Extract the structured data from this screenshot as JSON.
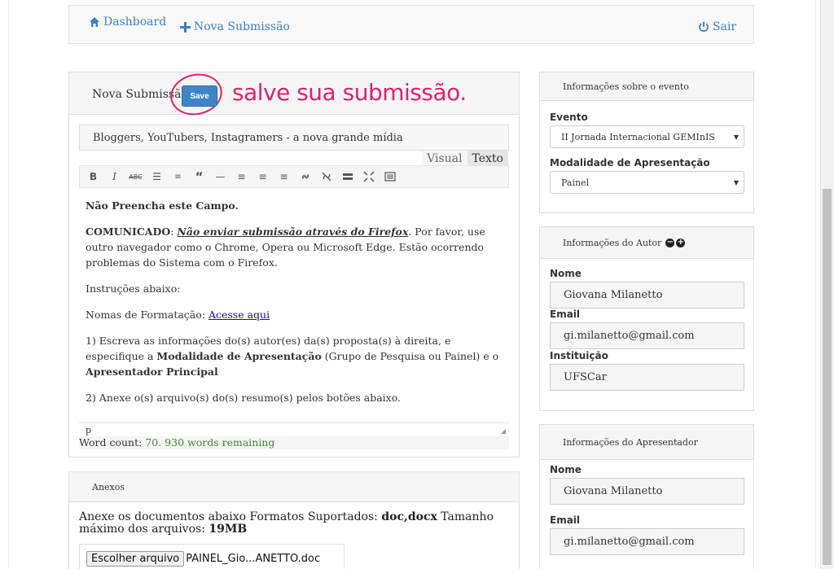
{
  "nav": {
    "dashboard": "Dashboard",
    "new_submission": "Nova Submissão",
    "logout": "Sair"
  },
  "submission": {
    "panel_title": "Nova Submissão",
    "save_label": "Save",
    "annotation": "salve sua submissão.",
    "title_value": "Bloggers, YouTubers, Instagramers - a nova grande mídia",
    "tabs": [
      "Visual",
      "Texto"
    ],
    "toolbar_icons": [
      "bold-icon",
      "italic-icon",
      "strikethrough-icon",
      "bullet-list-icon",
      "numbered-list-icon",
      "blockquote-icon",
      "horizontal-rule-icon",
      "align-left-icon",
      "align-center-icon",
      "align-right-icon",
      "link-icon",
      "unlink-icon",
      "read-more-icon",
      "fullscreen-icon",
      "toolbar-toggle-icon"
    ],
    "body": {
      "p1": "Não Preencha este Campo.",
      "p2_strong": "COMUNICADO",
      "p2_sep": ": ",
      "p2_em": "Não enviar submissão através do Firefox",
      "p2_rest": ". Por favor, use outro navegador como o Chrome, Opera ou Microsoft Edge. Estão ocorrendo problemas do Sistema com o Firefox.",
      "p3": "Instruções abaixo:",
      "p4_text": "Nomas de Formatação: ",
      "p4_link": "Acesse aqui",
      "p5_a": "1) Escreva as informações do(s) autor(es) da(s) proposta(s) à direita, e especifique a ",
      "p5_b": "Modalidade de Apresentação",
      "p5_c": " (Grupo de Pesquisa ou Painel) e o ",
      "p5_d": "Apresentador Principal",
      "p6": "2) Anexe o(s) arquivo(s) do(s) resumo(s) pelos botões abaixo."
    },
    "status_path": "p",
    "word_count_label": "Word count: ",
    "word_count_value": "70. 930 words remaining"
  },
  "anexos": {
    "title": "Anexos",
    "text_a": "Anexe os documentos abaixo Formatos Suportados: ",
    "formats": "doc,docx",
    "text_b": " Tamanho máximo dos arquivos: ",
    "max_size": "19MB",
    "file_button": "Escolher arquivo",
    "file_name": "PAINEL_Gio...ANETTO.doc"
  },
  "evento": {
    "title": "Informações sobre o evento",
    "event_label": "Evento",
    "event_value": "II Jornada Internacional GEMInIS",
    "modality_label": "Modalidade de Apresentação",
    "modality_value": "Painel"
  },
  "autor": {
    "title": "Informações do Autor",
    "name_label": "Nome",
    "name_value": "Giovana Milanetto",
    "email_label": "Email",
    "email_value": "gi.milanetto@gmail.com",
    "inst_label": "Instituição",
    "inst_value": "UFSCar"
  },
  "apresentador": {
    "title": "Informações do Apresentador",
    "name_label": "Nome",
    "name_value": "Giovana Milanetto",
    "email_label": "Email",
    "email_value": "gi.milanetto@gmail.com"
  },
  "colors": {
    "accent": "#3d7fbf",
    "save_button": "#3d85c6",
    "annotation": "#e0206e",
    "word_count_green": "#3a8a2a"
  }
}
